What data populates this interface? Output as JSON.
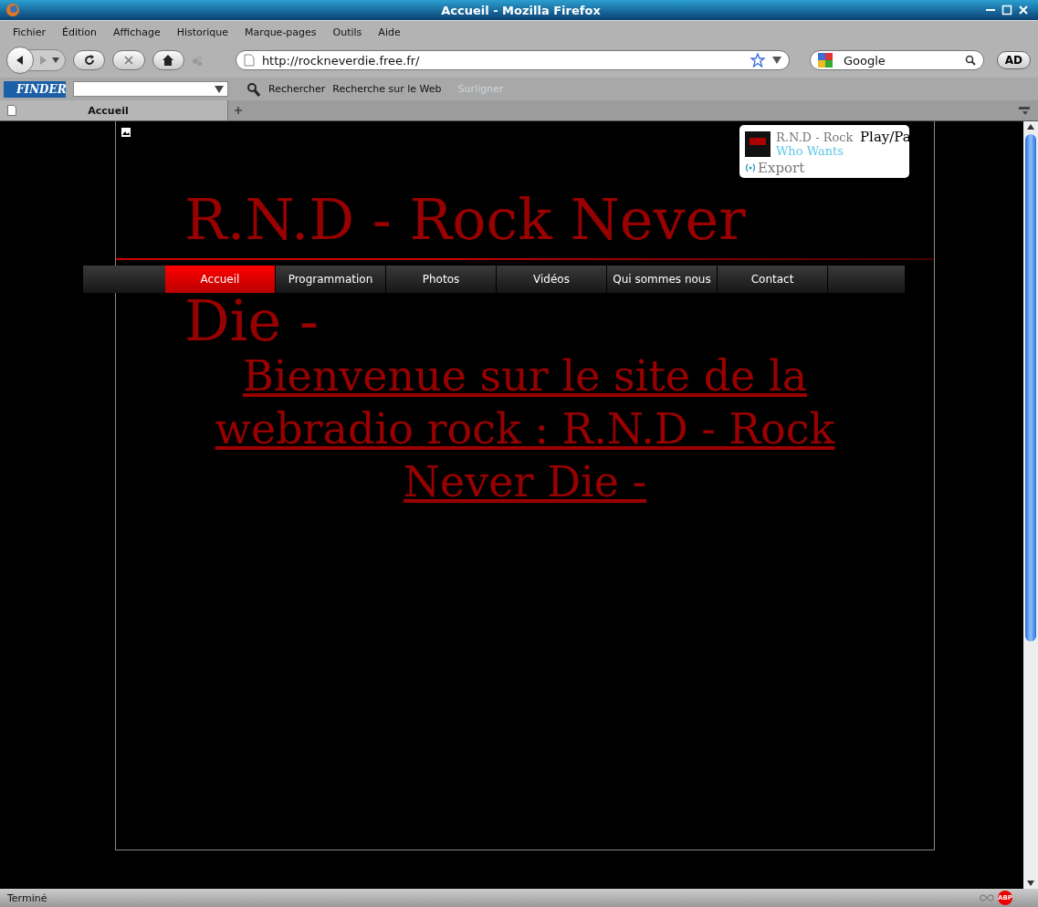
{
  "window": {
    "title": "Accueil - Mozilla Firefox"
  },
  "menu": [
    "Fichier",
    "Édition",
    "Affichage",
    "Historique",
    "Marque-pages",
    "Outils",
    "Aide"
  ],
  "navbar": {
    "url": "http://rockneverdie.free.fr/",
    "search_placeholder": "Google",
    "addon_button": "AD"
  },
  "finder_bar": {
    "logo": "FINDER",
    "items": [
      {
        "label": "Rechercher",
        "disabled": false
      },
      {
        "label": "Recherche sur le Web",
        "disabled": false
      },
      {
        "label": "Surligner",
        "disabled": true
      }
    ]
  },
  "tabs": [
    {
      "label": "Accueil",
      "selected": true
    }
  ],
  "page": {
    "heading_lines": [
      "R.N.D - Rock Never",
      "Die -"
    ],
    "player": {
      "title": "R.N.D - Rock",
      "track": "Who Wants",
      "button": "Play/Pa",
      "export": "Export"
    },
    "nav": [
      {
        "label": "Accueil",
        "selected": true
      },
      {
        "label": "Programmation",
        "selected": false
      },
      {
        "label": "Photos",
        "selected": false
      },
      {
        "label": "Vidéos",
        "selected": false
      },
      {
        "label": "Qui sommes nous",
        "selected": false
      },
      {
        "label": "Contact",
        "selected": false
      }
    ],
    "welcome": "Bienvenue sur le site de la webradio rock : R.N.D - Rock Never Die -"
  },
  "status_bar": {
    "text": "Terminé",
    "badge": "ABP"
  }
}
